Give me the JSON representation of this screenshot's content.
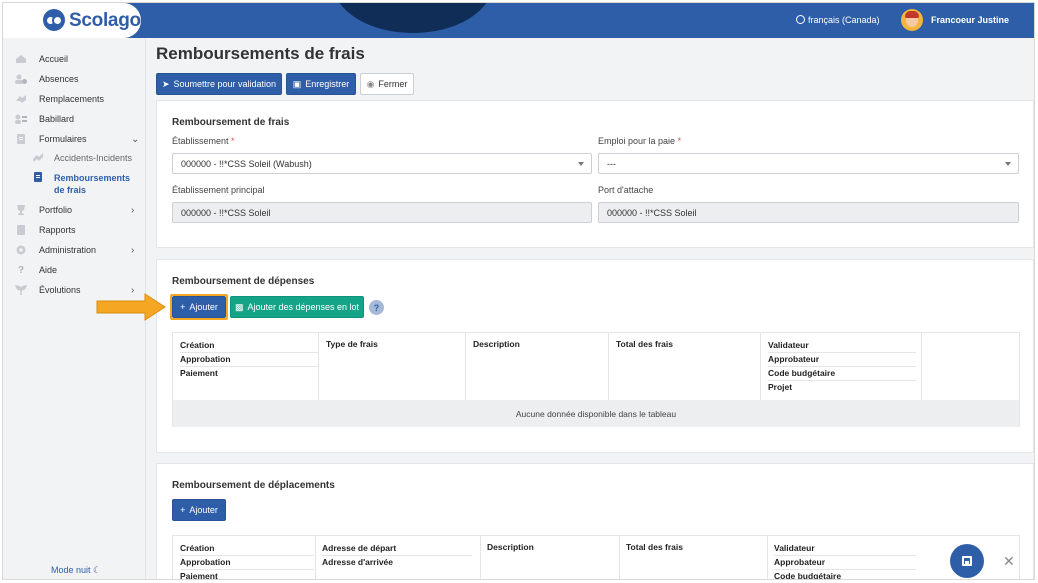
{
  "header": {
    "logo_text": "Scolago",
    "language": "français (Canada)",
    "user_name": "Francoeur Justine"
  },
  "sidebar": {
    "items": [
      {
        "label": "Accueil",
        "icon": "home-icon"
      },
      {
        "label": "Absences",
        "icon": "user-absence-icon"
      },
      {
        "label": "Remplacements",
        "icon": "swap-icon"
      },
      {
        "label": "Babillard",
        "icon": "board-icon"
      },
      {
        "label": "Formulaires",
        "icon": "form-icon",
        "expanded": true
      },
      {
        "label": "Portfolio",
        "icon": "trophy-icon"
      },
      {
        "label": "Rapports",
        "icon": "report-icon"
      },
      {
        "label": "Administration",
        "icon": "gear-icon"
      },
      {
        "label": "Aide",
        "icon": "question-icon"
      },
      {
        "label": "Évolutions",
        "icon": "sprout-icon"
      }
    ],
    "subitems": [
      {
        "label": "Accidents-Incidents",
        "icon": "accident-icon"
      },
      {
        "label_line1": "Remboursements",
        "label_line2": "de frais",
        "icon": "document-icon",
        "active": true
      }
    ],
    "night_mode": "Mode nuit"
  },
  "page": {
    "title": "Remboursements de frais",
    "toolbar": {
      "submit": "Soumettre pour validation",
      "save": "Enregistrer",
      "close": "Fermer"
    }
  },
  "card_frais": {
    "title": "Remboursement de frais",
    "etablissement_label": "Établissement",
    "etablissement_value": "000000 - !!*CSS Soleil (Wabush)",
    "emploi_label": "Emploi pour la paie",
    "emploi_value": "---",
    "etab_principal_label": "Établissement principal",
    "etab_principal_value": "000000 - !!*CSS Soleil",
    "port_label": "Port d'attache",
    "port_value": "000000 - !!*CSS Soleil",
    "required_mark": "*"
  },
  "card_depenses": {
    "title": "Remboursement de dépenses",
    "add_button": "Ajouter",
    "add_batch_button": "Ajouter des dépenses en lot",
    "help": "?",
    "columns": {
      "col1": [
        "Création",
        "Approbation",
        "Paiement"
      ],
      "col2": "Type de frais",
      "col3": "Description",
      "col4": "Total des frais",
      "col5": [
        "Validateur",
        "Approbateur",
        "Code budgétaire",
        "Projet"
      ]
    },
    "empty_message": "Aucune donnée disponible dans le tableau"
  },
  "card_deplacements": {
    "title": "Remboursement de déplacements",
    "add_button": "Ajouter",
    "columns": {
      "col1": [
        "Création",
        "Approbation",
        "Paiement"
      ],
      "col2": [
        "Adresse de départ",
        "Adresse d'arrivée"
      ],
      "col3": "Description",
      "col4": "Total des frais",
      "col5": [
        "Validateur",
        "Approbateur",
        "Code budgétaire"
      ]
    }
  },
  "colors": {
    "primary": "#2f5ea8",
    "teal": "#14a589",
    "highlight_arrow": "#f5a623"
  }
}
